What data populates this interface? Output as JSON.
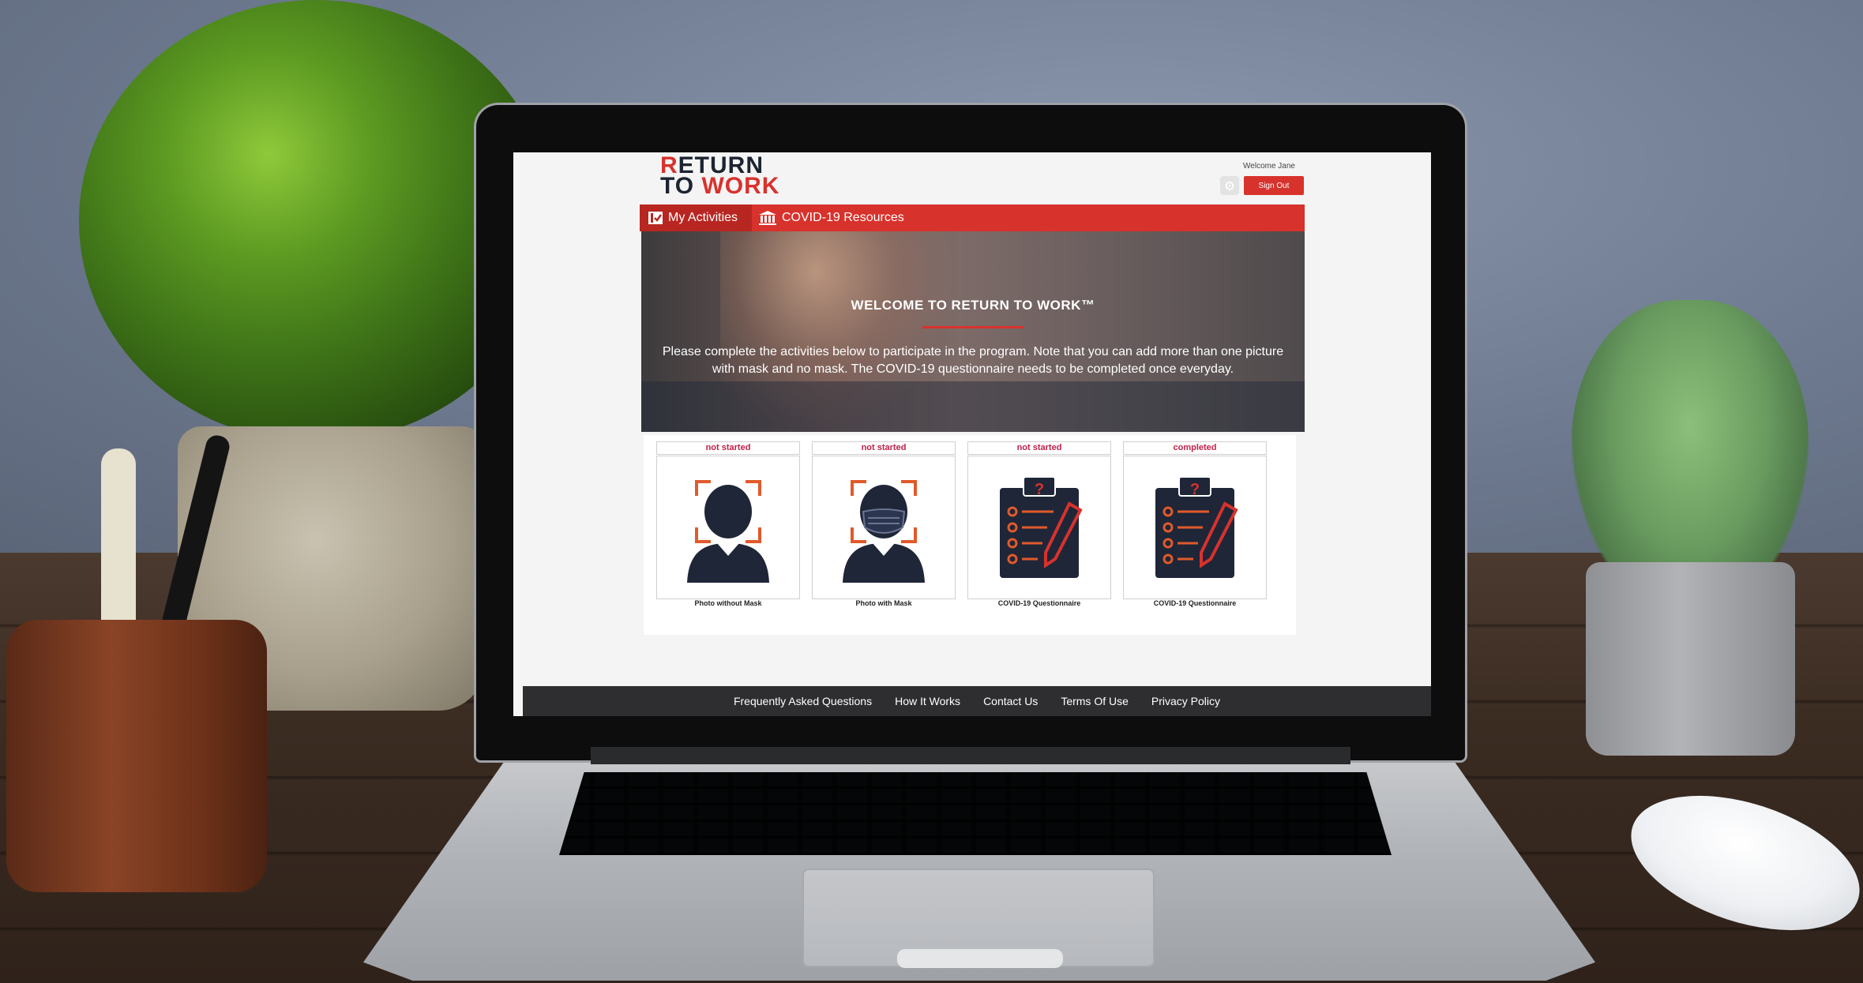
{
  "header": {
    "logo_line1_first": "R",
    "logo_line1_rest": "ETURN",
    "logo_line2_first": "TO ",
    "logo_line2_rest": "WORK",
    "welcome_text": "Welcome Jane",
    "settings_icon": "gear-icon",
    "signout_label": "Sign Out"
  },
  "nav": {
    "items": [
      {
        "label": "My Activities",
        "icon": "checklist-icon",
        "active": true
      },
      {
        "label": "COVID-19 Resources",
        "icon": "bank-icon",
        "active": false
      }
    ]
  },
  "hero": {
    "title": "WELCOME TO RETURN TO WORK™",
    "text": "Please complete the activities below to participate in the program. Note that you can add more than one picture with mask and no mask. The COVID-19 questionnaire needs to be completed once everyday."
  },
  "activities": [
    {
      "status": "not started",
      "label": "Photo without Mask",
      "icon": "face-scan-icon"
    },
    {
      "status": "not started",
      "label": "Photo with Mask",
      "icon": "face-mask-scan-icon"
    },
    {
      "status": "not started",
      "label": "COVID-19 Questionnaire",
      "icon": "clipboard-icon"
    },
    {
      "status": "completed",
      "label": "COVID-19 Questionnaire",
      "icon": "clipboard-icon"
    }
  ],
  "footer": {
    "links": [
      "Frequently Asked Questions",
      "How It Works",
      "Contact Us",
      "Terms Of Use",
      "Privacy Policy"
    ]
  },
  "colors": {
    "brand_red": "#d8322d",
    "navy": "#1c2431",
    "status_red": "#c0214a",
    "footer_bg": "#2e2e30"
  }
}
